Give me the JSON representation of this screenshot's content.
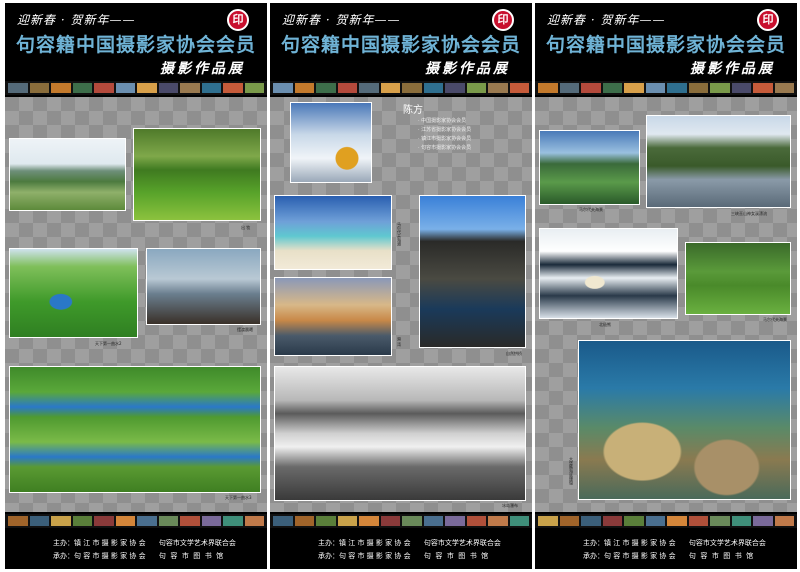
{
  "header": {
    "greeting": "迎新春 · 贺新年——",
    "seal": "印",
    "title": "句容籍中国摄影家协会会员",
    "subtitle": "摄影作品展"
  },
  "footer": {
    "organizer": "主办：镇 江 市 摄 影 家 协 会      句容市文学艺术界联合会",
    "undertaker": "承办：句 容 市 摄 影 家 协 会      句  容  市  图  书  馆"
  },
  "panel2": {
    "name": "陈方",
    "members": [
      "· 中国摄影家协会会员",
      "· 江苏省摄影家协会会员",
      "· 镇江市摄影家协会会员",
      "· 句容市摄影家协会会员"
    ]
  },
  "captions": {
    "p1_c1": "出 牧",
    "p1_c2": "天下第一曲水2",
    "p1_c3": "摆渡晨曦",
    "p1_c4": "天下第一曲水3",
    "p2_c1": "马尔代夫海滩",
    "p2_c2": "港 湾",
    "p2_c3": "自然拱桥",
    "p2_c4": "冰岛瀑布",
    "p3_c1": "马尔代夫海景",
    "p3_c2": "三峡巫山神女溪漂流",
    "p3_c3": "北极熊",
    "p3_c4": "马尔代夫海景",
    "p3_c5": "大堡礁海底珊瑚"
  },
  "colors": {
    "title": "#6fb3d6",
    "seal": "#c8102e",
    "background_gray": "#8f8f8f"
  }
}
